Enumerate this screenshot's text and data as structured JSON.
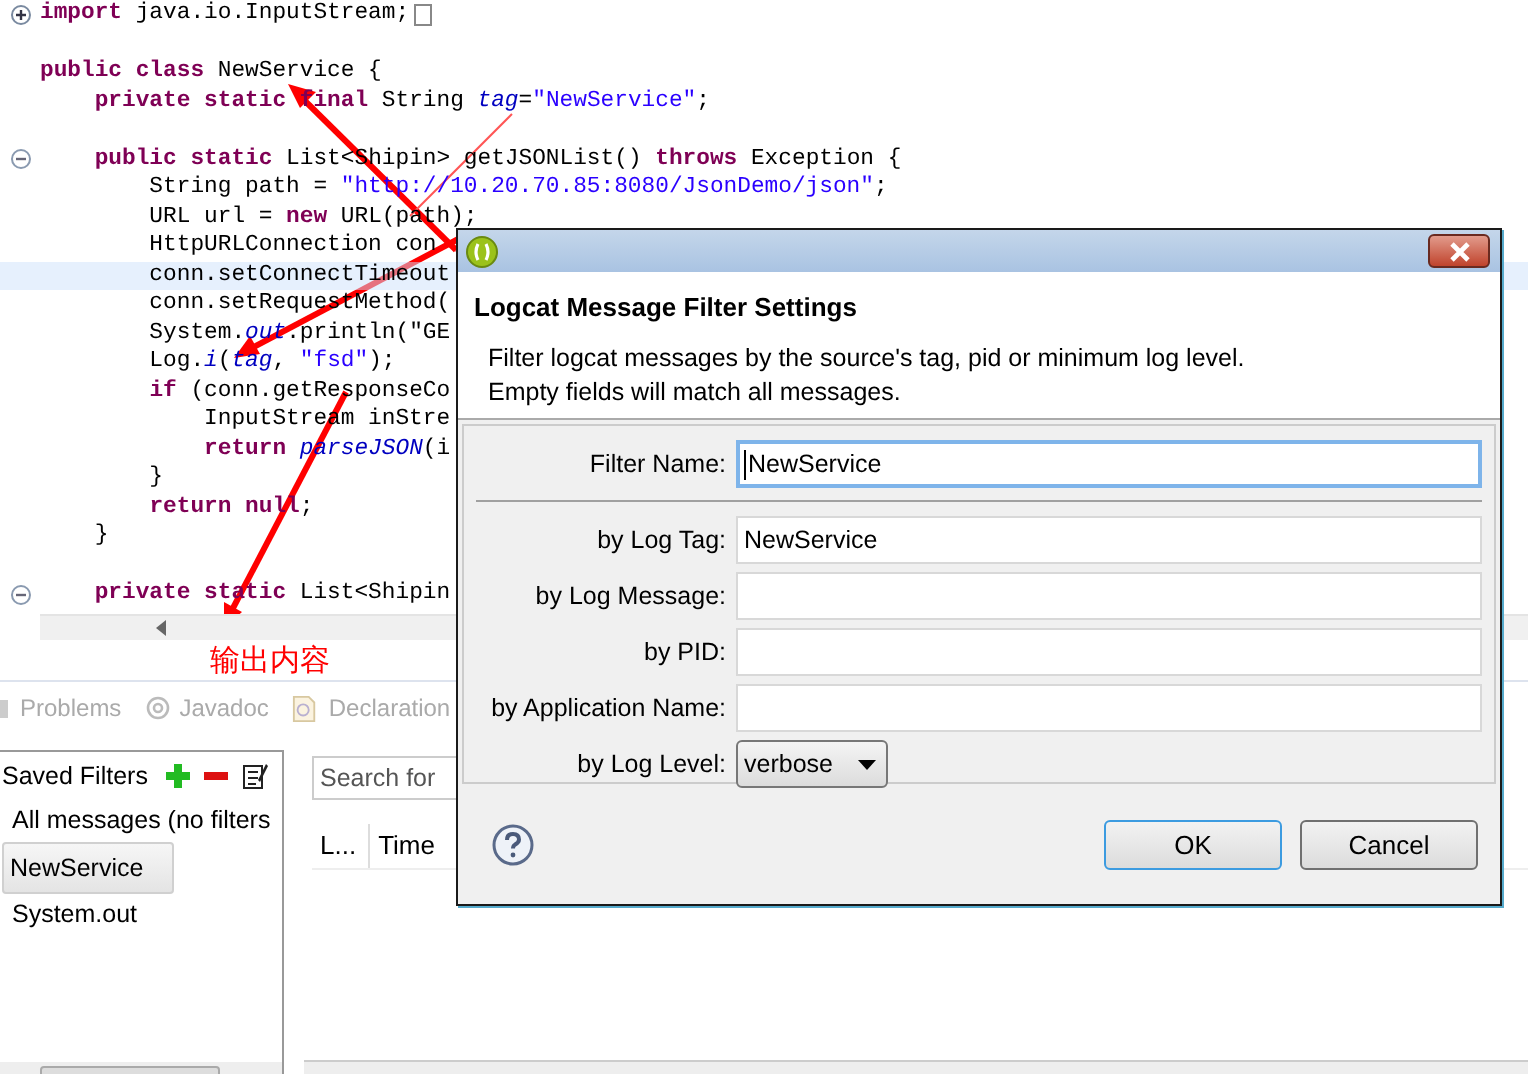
{
  "editor": {
    "lines": [
      {
        "kind": "collapsed",
        "current": false,
        "text": "**import** java.io.InputStream;"
      },
      {
        "kind": "plain",
        "current": false
      },
      {
        "kind": "plain",
        "current": false,
        "text": "**public class** NewService {"
      },
      {
        "kind": "plain",
        "current": false,
        "text": "    **private static final** String *tag*=\"NewService\";"
      },
      {
        "kind": "plain",
        "current": false
      },
      {
        "kind": "expanded",
        "current": false,
        "text": "    **public static** List<Shipin> getJSONList() **throws** Exception {"
      },
      {
        "kind": "plain",
        "current": false,
        "text": "        String path = \"http://10.20.70.85:8080/JsonDemo/json\";"
      },
      {
        "kind": "plain",
        "current": false,
        "text": "        URL url = **new** URL(path);"
      },
      {
        "kind": "plain",
        "current": false,
        "text": "        HttpURLConnection con"
      },
      {
        "kind": "plain",
        "current": true,
        "text": "        conn.setConnectTimeout"
      },
      {
        "kind": "plain",
        "current": false,
        "text": "        conn.setRequestMethod("
      },
      {
        "kind": "plain",
        "current": false,
        "text": "        System.*out*.println(\"GE"
      },
      {
        "kind": "plain",
        "current": false,
        "text": "        Log.*i*(*tag*, \"fsd\");"
      },
      {
        "kind": "plain",
        "current": false,
        "text": "        **if** (conn.getResponseCo"
      },
      {
        "kind": "plain",
        "current": false,
        "text": "            InputStream inStre"
      },
      {
        "kind": "plain",
        "current": false,
        "text": "            **return** *parseJSON*(i"
      },
      {
        "kind": "plain",
        "current": false,
        "text": "        }"
      },
      {
        "kind": "plain",
        "current": false,
        "text": "        **return null**;"
      },
      {
        "kind": "plain",
        "current": false,
        "text": "    }"
      },
      {
        "kind": "plain",
        "current": false
      },
      {
        "kind": "expanded",
        "current": false,
        "text": "    **private static** List<Shipin"
      }
    ]
  },
  "annotation": {
    "text": "输出内容"
  },
  "view_tabs": [
    {
      "label": "Problems"
    },
    {
      "label": "Javadoc"
    },
    {
      "label": "Declaration"
    }
  ],
  "saved_filters": {
    "title": "Saved Filters",
    "items": [
      {
        "label": "All messages (no filters",
        "selected": false
      },
      {
        "label": "NewService",
        "selected": true
      },
      {
        "label": "System.out",
        "selected": false
      }
    ]
  },
  "log": {
    "search": {
      "placeholder": "Search for"
    },
    "columns": [
      "L...",
      "Time"
    ]
  },
  "dialog": {
    "heading": "Logcat Message Filter Settings",
    "description": [
      "Filter logcat messages by the source's tag, pid or minimum log level.",
      "Empty fields will match all messages."
    ],
    "fields": [
      {
        "kind": "text",
        "label": "Filter Name:",
        "value": "NewService",
        "focused": true,
        "separator_after": true
      },
      {
        "kind": "text",
        "label": "by Log Tag:",
        "value": "NewService",
        "focused": false,
        "separator_after": false
      },
      {
        "kind": "text",
        "label": "by Log Message:",
        "focused": false,
        "separator_after": false
      },
      {
        "kind": "text",
        "label": "by PID:",
        "focused": false,
        "separator_after": false
      },
      {
        "kind": "text",
        "label": "by Application Name:",
        "focused": false,
        "separator_after": false
      },
      {
        "kind": "select",
        "label": "by Log Level:",
        "value": "verbose",
        "focused": false,
        "separator_after": false
      }
    ],
    "buttons": [
      {
        "label": "OK",
        "default": true
      },
      {
        "label": "Cancel",
        "default": false
      }
    ]
  }
}
